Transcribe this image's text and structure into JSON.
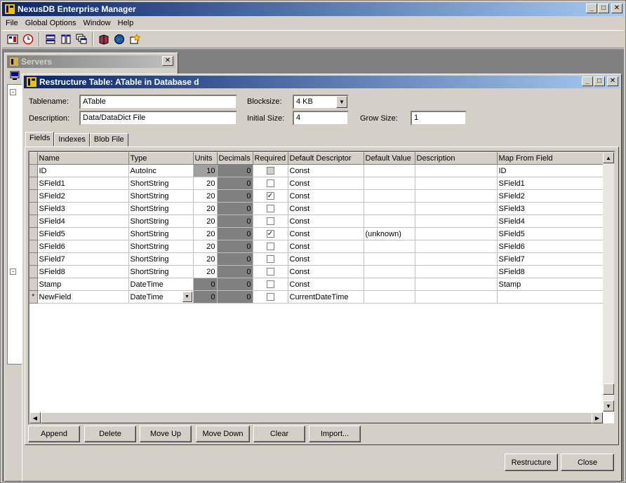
{
  "app": {
    "title": "NexusDB Enterprise Manager",
    "menu": [
      "File",
      "Global Options",
      "Window",
      "Help"
    ],
    "toolbar_icons": [
      "sql-icon",
      "clock-icon",
      "tile-horizontal-icon",
      "tile-vertical-icon",
      "cascade-icon",
      "book-icon",
      "globe-icon",
      "star-icon"
    ]
  },
  "servers": {
    "title": "Servers"
  },
  "dialog": {
    "title": "Restructure Table: ATable in Database d",
    "tablename_label": "Tablename:",
    "tablename_value": "ATable",
    "description_label": "Description:",
    "description_value": "Data/DataDict File",
    "blocksize_label": "Blocksize:",
    "blocksize_value": "4 KB",
    "initial_size_label": "Initial Size:",
    "initial_size_value": "4",
    "grow_size_label": "Grow Size:",
    "grow_size_value": "1",
    "tabs": [
      "Fields",
      "Indexes",
      "Blob File"
    ],
    "columns": [
      "Name",
      "Type",
      "Units",
      "Decimals",
      "Required",
      "Default Descriptor",
      "Default Value",
      "Description",
      "Map From Field"
    ],
    "rows": [
      {
        "name": "ID",
        "type": "AutoInc",
        "units": "10",
        "decimals": "0",
        "required": false,
        "required_disabled": true,
        "default_descriptor": "Const",
        "default_value": "",
        "description": "",
        "map_from": "ID"
      },
      {
        "name": "SField1",
        "type": "ShortString",
        "units": "20",
        "decimals": "0",
        "required": false,
        "default_descriptor": "Const",
        "default_value": "",
        "description": "",
        "map_from": "SField1"
      },
      {
        "name": "SField2",
        "type": "ShortString",
        "units": "20",
        "decimals": "0",
        "required": true,
        "default_descriptor": "Const",
        "default_value": "",
        "description": "",
        "map_from": "SField2"
      },
      {
        "name": "SField3",
        "type": "ShortString",
        "units": "20",
        "decimals": "0",
        "required": false,
        "default_descriptor": "Const",
        "default_value": "",
        "description": "",
        "map_from": "SField3"
      },
      {
        "name": "SField4",
        "type": "ShortString",
        "units": "20",
        "decimals": "0",
        "required": false,
        "default_descriptor": "Const",
        "default_value": "",
        "description": "",
        "map_from": "SField4"
      },
      {
        "name": "SField5",
        "type": "ShortString",
        "units": "20",
        "decimals": "0",
        "required": true,
        "default_descriptor": "Const",
        "default_value": "(unknown)",
        "description": "",
        "map_from": "SField5"
      },
      {
        "name": "SField6",
        "type": "ShortString",
        "units": "20",
        "decimals": "0",
        "required": false,
        "default_descriptor": "Const",
        "default_value": "",
        "description": "",
        "map_from": "SField6"
      },
      {
        "name": "SField7",
        "type": "ShortString",
        "units": "20",
        "decimals": "0",
        "required": false,
        "default_descriptor": "Const",
        "default_value": "",
        "description": "",
        "map_from": "SField7"
      },
      {
        "name": "SField8",
        "type": "ShortString",
        "units": "20",
        "decimals": "0",
        "required": false,
        "default_descriptor": "Const",
        "default_value": "",
        "description": "",
        "map_from": "SField8"
      },
      {
        "name": "Stamp",
        "type": "DateTime",
        "units": "0",
        "decimals": "0",
        "required": false,
        "default_descriptor": "Const",
        "default_value": "",
        "description": "",
        "map_from": "Stamp"
      },
      {
        "name": "NewField",
        "type": "DateTime",
        "units": "0",
        "decimals": "0",
        "required": false,
        "default_descriptor": "CurrentDateTime",
        "default_value": "",
        "description": "",
        "map_from": "",
        "indicator": "*",
        "editing": true
      }
    ],
    "buttons": [
      "Append",
      "Delete",
      "Move Up",
      "Move Down",
      "Clear",
      "Import..."
    ],
    "restructure_label": "Restructure",
    "close_label": "Close"
  },
  "colors": {
    "titlebar_active": "#0a246a",
    "window_face": "#d4d0c8",
    "mdi_bg": "#808080"
  }
}
